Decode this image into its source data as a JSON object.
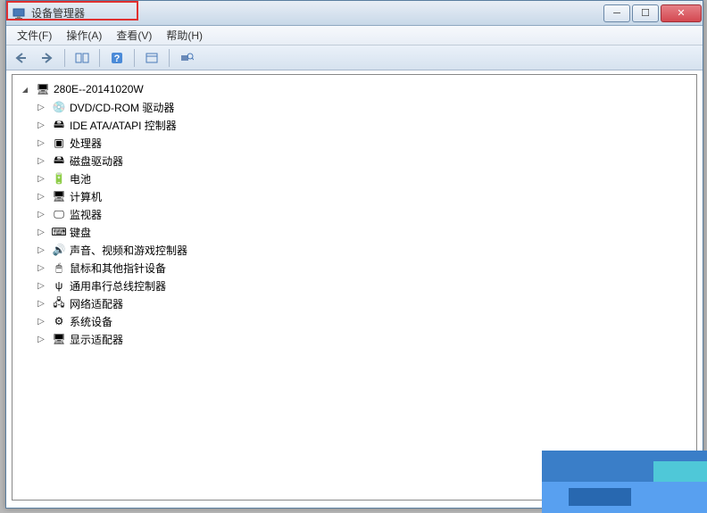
{
  "title": "设备管理器",
  "menus": {
    "file": "文件(F)",
    "action": "操作(A)",
    "view": "查看(V)",
    "help": "帮助(H)"
  },
  "win_controls": {
    "minimize_glyph": "─",
    "maximize_glyph": "☐",
    "close_glyph": "✕"
  },
  "tree": {
    "root": {
      "label": "280E--20141020W",
      "expanded": true,
      "icon": "computer"
    },
    "children": [
      {
        "label": "DVD/CD-ROM 驱动器",
        "icon": "disc"
      },
      {
        "label": "IDE ATA/ATAPI 控制器",
        "icon": "controller"
      },
      {
        "label": "处理器",
        "icon": "cpu"
      },
      {
        "label": "磁盘驱动器",
        "icon": "disk"
      },
      {
        "label": "电池",
        "icon": "battery"
      },
      {
        "label": "计算机",
        "icon": "pc"
      },
      {
        "label": "监视器",
        "icon": "monitor"
      },
      {
        "label": "键盘",
        "icon": "keyboard"
      },
      {
        "label": "声音、视频和游戏控制器",
        "icon": "sound"
      },
      {
        "label": "鼠标和其他指针设备",
        "icon": "mouse"
      },
      {
        "label": "通用串行总线控制器",
        "icon": "usb"
      },
      {
        "label": "网络适配器",
        "icon": "network"
      },
      {
        "label": "系统设备",
        "icon": "system"
      },
      {
        "label": "显示适配器",
        "icon": "display"
      }
    ]
  },
  "icons": {
    "computer": "🖥",
    "disc": "💿",
    "controller": "🖴",
    "cpu": "▣",
    "disk": "🖴",
    "battery": "🔋",
    "pc": "🖥",
    "monitor": "🖵",
    "keyboard": "⌨",
    "sound": "🔊",
    "mouse": "🖱",
    "usb": "ψ",
    "network": "🖧",
    "system": "⚙",
    "display": "🖥"
  }
}
